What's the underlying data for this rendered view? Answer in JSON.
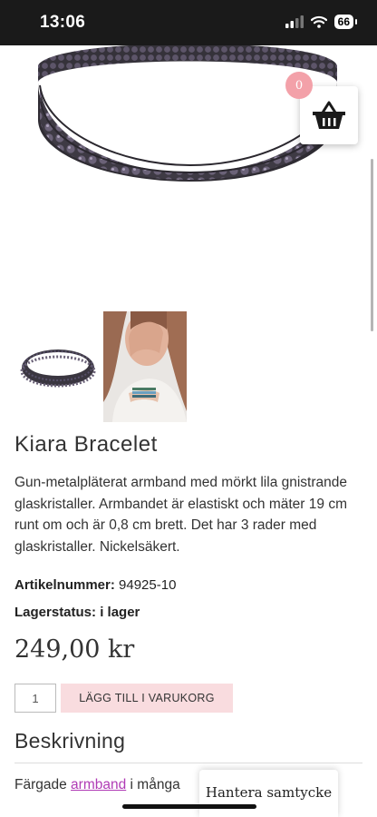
{
  "status_bar": {
    "time": "13:06",
    "battery": "66"
  },
  "cart": {
    "count": "0",
    "icon": "basket-icon"
  },
  "product": {
    "title": "Kiara Bracelet",
    "description": "Gun-metalpläterat armband med mörkt lila gnistrande glaskristaller. Armbandet är elastiskt och mäter 19 cm runt om och är 0,8 cm brett. Det har 3 rader med glaskristaller. Nickelsäkert.",
    "sku_label": "Artikelnummer:",
    "sku_value": "94925-10",
    "stock_label": "Lagerstatus: i lager",
    "price": "249,00 kr"
  },
  "purchase": {
    "quantity": "1",
    "add_button": "LÄGG TILL I VARUKORG"
  },
  "description_section": {
    "title": "Beskrivning",
    "text_before": "Färgade ",
    "link_text": "armband",
    "text_after": " i många"
  },
  "consent": {
    "label": "Hantera samtycke"
  },
  "colors": {
    "accent_pink": "#f9dcdf",
    "badge_pink": "#f3a1a9",
    "link_purple": "#b03bb5"
  }
}
